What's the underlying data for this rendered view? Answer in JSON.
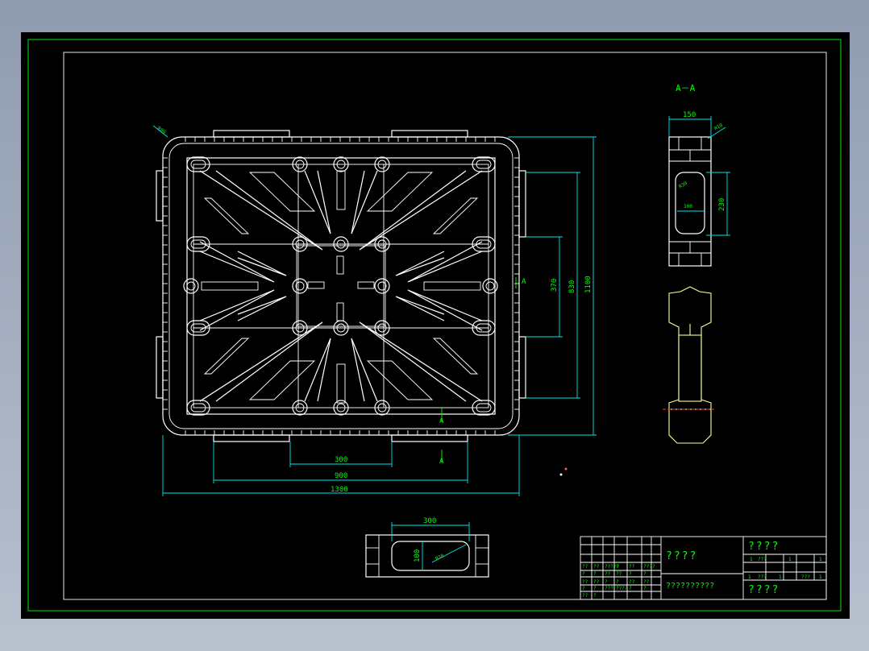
{
  "section_title": "A－A",
  "section_mark": "A",
  "corner_radius": "R80",
  "dims": {
    "d300": "300",
    "d900": "900",
    "d1300": "1300",
    "d370": "370",
    "d830": "830",
    "d1100": "1100",
    "d150": "150",
    "r10": "R10",
    "r30": "R30",
    "d100": "100",
    "d230": "230",
    "bottom300": "300",
    "bottom100": "100",
    "bottomR30": "R30"
  },
  "title_block": {
    "name": "????",
    "material": "??????????",
    "drawing_no": "????",
    "company": "????",
    "scale_row": [
      "1",
      "???",
      "1",
      "1"
    ],
    "sheet_row": [
      "1",
      "???",
      "1",
      "???",
      "1"
    ],
    "grid_labels": [
      "??",
      "??",
      "?????",
      "?",
      "??",
      "????",
      "?",
      "?",
      "??",
      "??",
      "?",
      "?",
      "??",
      "??",
      "?",
      "?",
      "??",
      "??",
      "?",
      "?",
      "???",
      "????",
      "?",
      "?",
      "??",
      "?"
    ]
  },
  "colors": {
    "background": "#000000",
    "frame": "#00ff00",
    "geometry": "#ffffff",
    "dimension": "#00e8e8",
    "section": "#ffff99"
  }
}
